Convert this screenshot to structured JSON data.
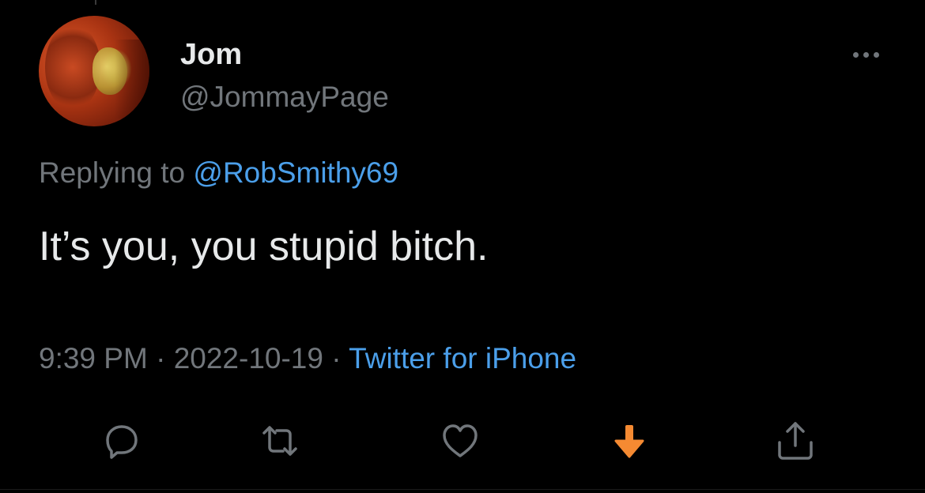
{
  "tweet": {
    "author": {
      "display_name": "Jom",
      "handle": "@JommayPage"
    },
    "reply_prefix": "Replying to ",
    "reply_to": "@RobSmithy69",
    "text": "It’s you, you stupid bitch.",
    "time": "9:39 PM",
    "separator1": " · ",
    "date": "2022-10-19",
    "separator2": " · ",
    "source": "Twitter for iPhone"
  },
  "actions": [
    {
      "name": "reply",
      "icon": "reply-icon"
    },
    {
      "name": "retweet",
      "icon": "retweet-icon"
    },
    {
      "name": "like",
      "icon": "heart-icon"
    },
    {
      "name": "download",
      "icon": "download-arrow-icon"
    },
    {
      "name": "share",
      "icon": "share-icon"
    }
  ],
  "colors": {
    "background": "#000000",
    "text_primary": "#e7e9ea",
    "text_secondary": "#71767b",
    "link": "#4b9fea",
    "download_accent": "#f58a32"
  }
}
